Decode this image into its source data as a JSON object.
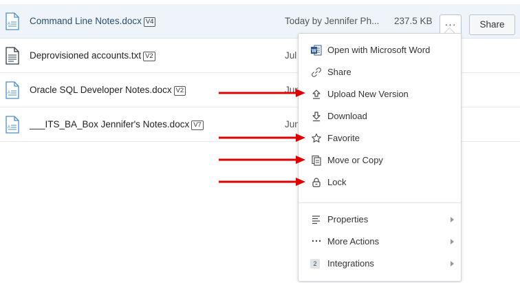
{
  "files": [
    {
      "name": "Command Line Notes.docx",
      "version": "V4",
      "modified": "Today by Jennifer Ph...",
      "size": "237.5 KB",
      "icon": "docx-file-icon"
    },
    {
      "name": "Deprovisioned accounts.txt",
      "version": "V2",
      "modified": "Jul",
      "icon": "txt-file-icon"
    },
    {
      "name": "Oracle SQL Developer Notes.docx",
      "version": "V2",
      "modified": "Jun",
      "icon": "docx-file-icon"
    },
    {
      "name": "___ITS_BA_Box Jennifer's Notes.docx",
      "version": "V7",
      "modified": "Jun",
      "icon": "docx-file-icon"
    }
  ],
  "row_actions": {
    "more_label": "···",
    "share_label": "Share"
  },
  "menu": {
    "items": [
      {
        "label": "Open with Microsoft Word",
        "icon": "word-icon"
      },
      {
        "label": "Share",
        "icon": "link-icon"
      },
      {
        "label": "Upload New Version",
        "icon": "upload-icon"
      },
      {
        "label": "Download",
        "icon": "download-icon"
      },
      {
        "label": "Favorite",
        "icon": "star-icon"
      },
      {
        "label": "Move or Copy",
        "icon": "copy-icon"
      },
      {
        "label": "Lock",
        "icon": "lock-icon"
      }
    ],
    "submenus": [
      {
        "label": "Properties",
        "icon": "properties-icon"
      },
      {
        "label": "More Actions",
        "icon": "ellipsis-icon"
      },
      {
        "label": "Integrations",
        "icon": "integrations-badge",
        "badge": "2"
      }
    ]
  },
  "colors": {
    "accent_blue": "#2a4d6e",
    "selected_row": "#eef4fa",
    "annotation_red": "#e00000",
    "word_blue": "#2b579a"
  }
}
